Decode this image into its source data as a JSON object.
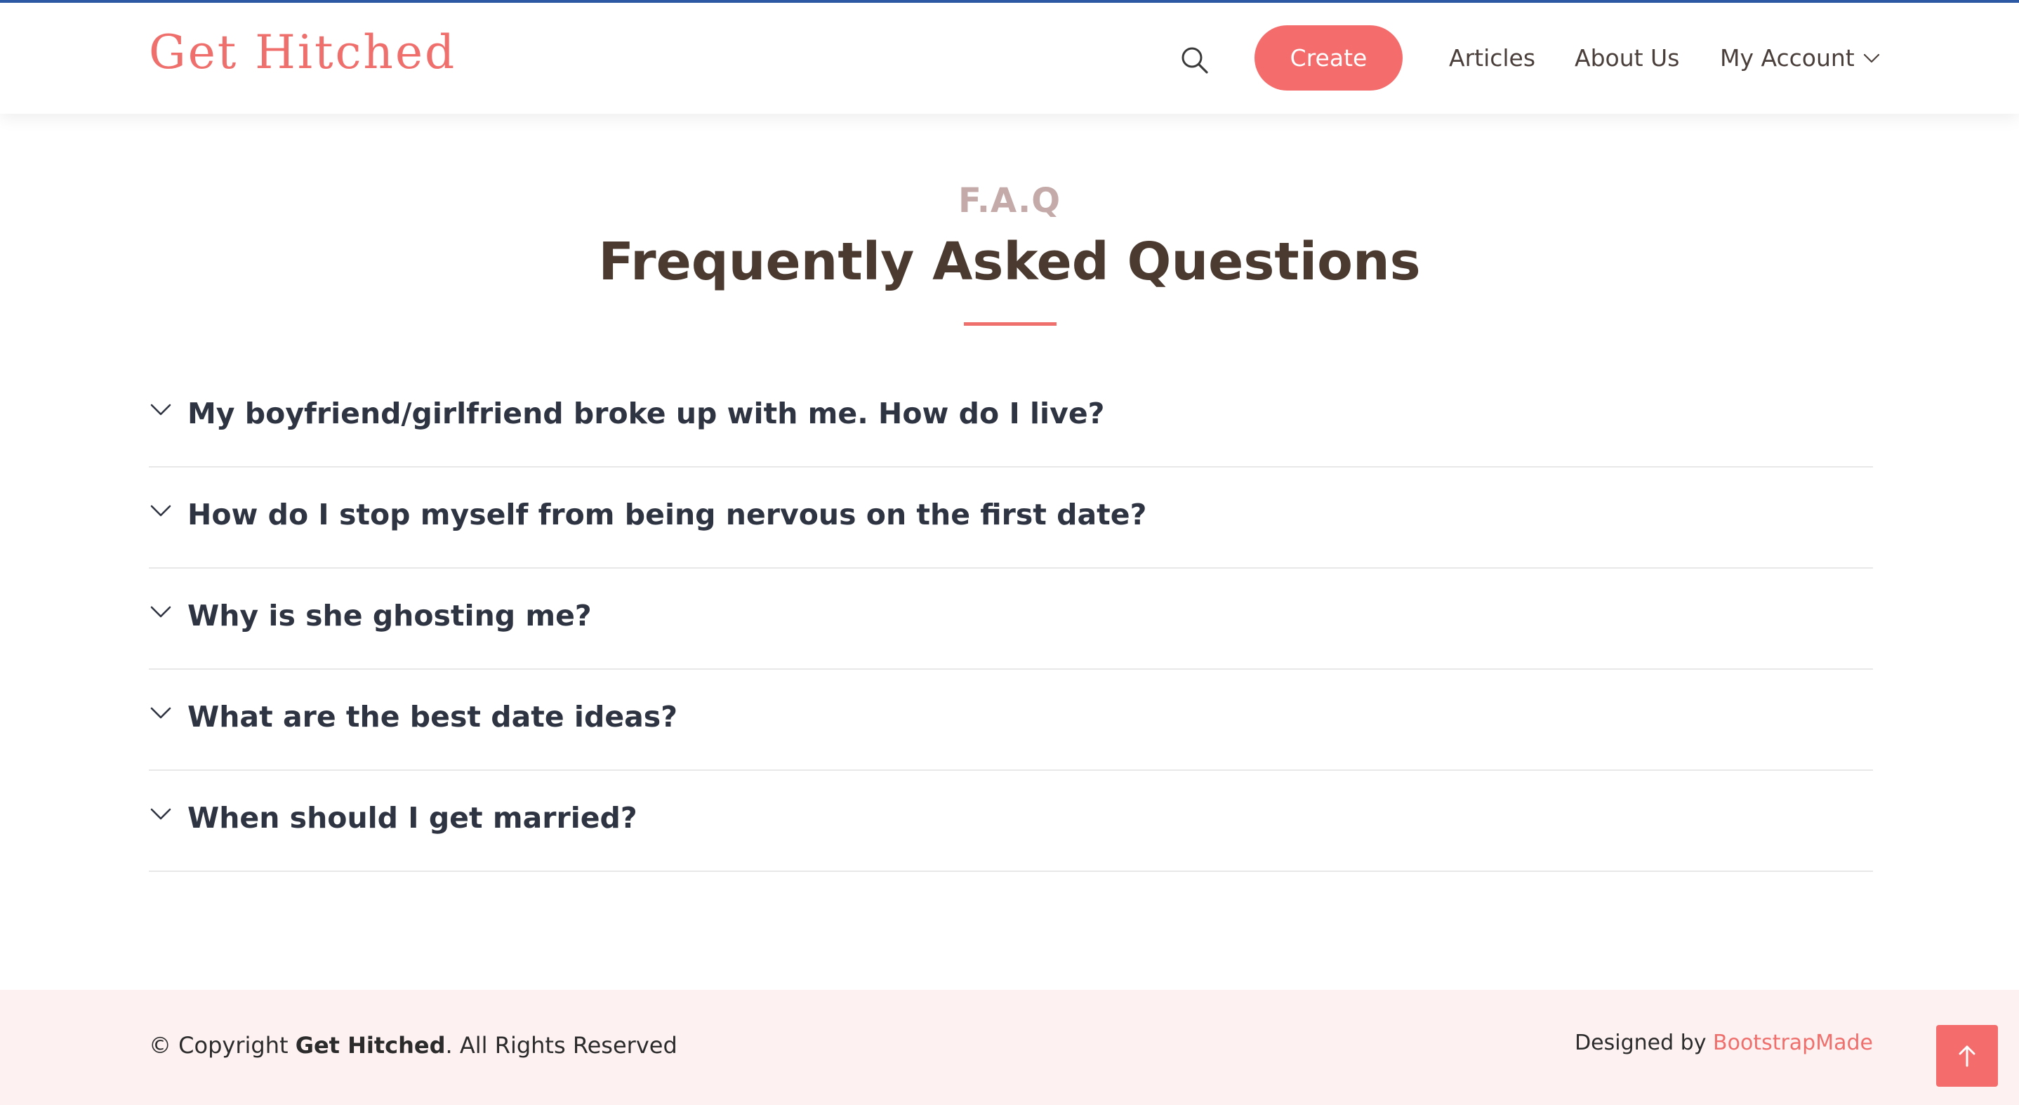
{
  "header": {
    "logo": "Get Hitched",
    "create_label": "Create",
    "nav": {
      "articles": "Articles",
      "about": "About Us",
      "account": "My Account"
    }
  },
  "faq": {
    "eyebrow": "F.A.Q",
    "title": "Frequently Asked Questions",
    "items": [
      {
        "question": "My boyfriend/girlfriend broke up with me. How do I live?"
      },
      {
        "question": "How do I stop myself from being nervous on the first date?"
      },
      {
        "question": "Why is she ghosting me?"
      },
      {
        "question": "What are the best date ideas?"
      },
      {
        "question": "When should I get married?"
      }
    ]
  },
  "footer": {
    "copyright_prefix": "© Copyright ",
    "copyright_brand": "Get Hitched",
    "copyright_suffix": ". All Rights Reserved",
    "designed_by": "Designed by ",
    "designer_link": "BootstrapMade"
  },
  "colors": {
    "brand": "#ef6f6c",
    "top_accent": "#2d5aa6",
    "heading": "#4b3a30",
    "eyebrow": "#c4aaa8",
    "footer_bg": "#fdf1f1"
  },
  "icons": {
    "search": "search-icon",
    "account_dropdown": "chevron-down-icon",
    "faq_toggle": "chevron-down-icon",
    "back_to_top": "arrow-up-icon"
  }
}
